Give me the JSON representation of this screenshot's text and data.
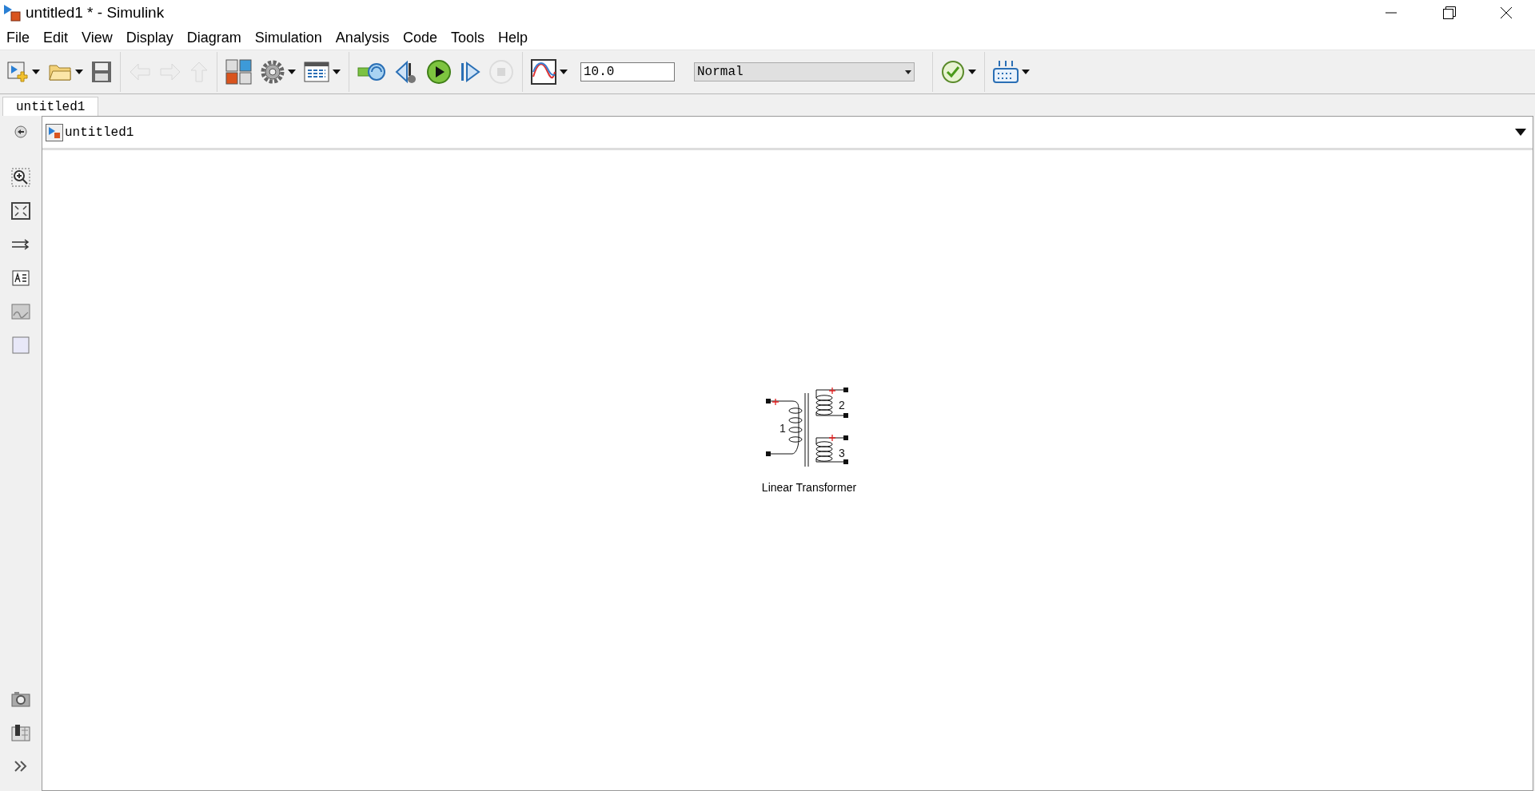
{
  "window": {
    "title": "untitled1 * - Simulink"
  },
  "menu": [
    "File",
    "Edit",
    "View",
    "Display",
    "Diagram",
    "Simulation",
    "Analysis",
    "Code",
    "Tools",
    "Help"
  ],
  "toolbar": [
    {
      "kind": "new",
      "disabled": false,
      "dropdown": true
    },
    {
      "kind": "open",
      "disabled": false,
      "dropdown": true
    },
    {
      "kind": "save",
      "disabled": false,
      "dropdown": false
    },
    {
      "kind": "separator"
    },
    {
      "kind": "back",
      "disabled": true,
      "dropdown": false
    },
    {
      "kind": "forward",
      "disabled": true,
      "dropdown": false
    },
    {
      "kind": "up",
      "disabled": true,
      "dropdown": false
    },
    {
      "kind": "separator"
    },
    {
      "kind": "library",
      "disabled": false,
      "dropdown": false
    },
    {
      "kind": "gear",
      "disabled": false,
      "dropdown": true
    },
    {
      "kind": "explorer",
      "disabled": false,
      "dropdown": true
    },
    {
      "kind": "separator"
    },
    {
      "kind": "update",
      "disabled": false,
      "dropdown": false
    },
    {
      "kind": "step_back",
      "disabled": false,
      "dropdown": false
    },
    {
      "kind": "run",
      "disabled": false,
      "dropdown": false
    },
    {
      "kind": "step_forward",
      "disabled": false,
      "dropdown": false
    },
    {
      "kind": "stop",
      "disabled": true,
      "dropdown": false
    },
    {
      "kind": "separator"
    },
    {
      "kind": "scope",
      "disabled": false,
      "dropdown": true
    },
    {
      "kind": "stop_time",
      "value": "10.0"
    },
    {
      "kind": "mode",
      "value": "Normal"
    },
    {
      "kind": "separator"
    },
    {
      "kind": "check",
      "disabled": false,
      "dropdown": true
    },
    {
      "kind": "separator"
    },
    {
      "kind": "grid",
      "disabled": false,
      "dropdown": true
    }
  ],
  "tabs": [
    {
      "label": "untitled1",
      "selected": true
    }
  ],
  "breadcrumb": {
    "label": "untitled1"
  },
  "palette": [
    {
      "kind": "back"
    },
    {
      "kind": "zoom"
    },
    {
      "kind": "fit"
    },
    {
      "kind": "arrows"
    },
    {
      "kind": "annotation"
    },
    {
      "kind": "image"
    },
    {
      "kind": "area"
    }
  ],
  "palette_bottom": [
    {
      "kind": "camera"
    },
    {
      "kind": "report"
    },
    {
      "kind": "more"
    }
  ],
  "block": {
    "label": "Linear Transformer",
    "windings": [
      {
        "label": "1"
      },
      {
        "label": "2"
      },
      {
        "label": "3"
      }
    ]
  }
}
